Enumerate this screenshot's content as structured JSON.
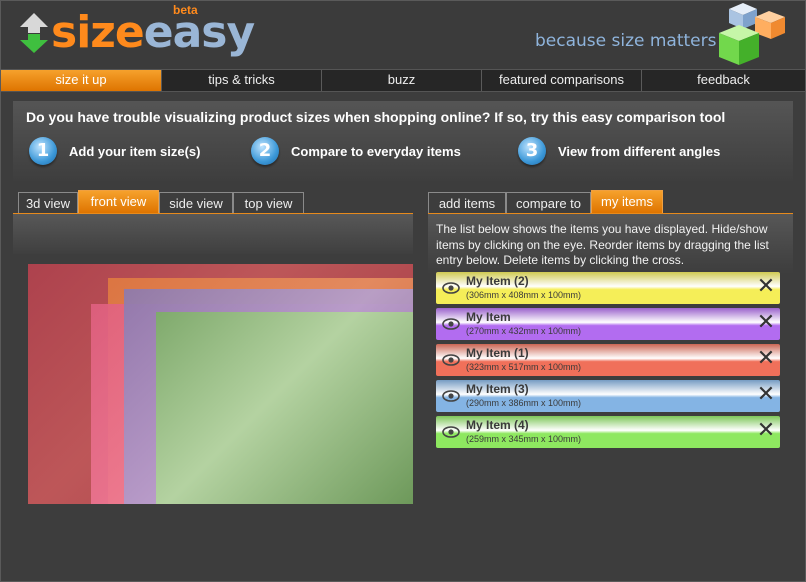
{
  "logo": {
    "text_size": "size",
    "text_easy": "easy",
    "badge": "beta",
    "tagline": "because size matters"
  },
  "nav": {
    "items": [
      {
        "label": "size it up",
        "active": true
      },
      {
        "label": "tips & tricks",
        "active": false
      },
      {
        "label": "buzz",
        "active": false
      },
      {
        "label": "featured comparisons",
        "active": false
      },
      {
        "label": "feedback",
        "active": false
      }
    ]
  },
  "banner": {
    "title": "Do you have trouble visualizing product sizes when shopping online? If so, try this easy comparison tool",
    "steps": [
      {
        "number": "1",
        "label": "Add your item size(s)"
      },
      {
        "number": "2",
        "label": "Compare to everyday items"
      },
      {
        "number": "3",
        "label": "View from different angles"
      }
    ]
  },
  "view_tabs": [
    {
      "label": "3d view",
      "active": false
    },
    {
      "label": "front view",
      "active": true
    },
    {
      "label": "side view",
      "active": false
    },
    {
      "label": "top view",
      "active": false
    }
  ],
  "item_tabs": [
    {
      "label": "add items",
      "active": false
    },
    {
      "label": "compare to",
      "active": false
    },
    {
      "label": "my items",
      "active": true
    }
  ],
  "instructions": "The list below shows the items you have displayed. Hide/show items by clicking on the eye. Reorder items by dragging the list entry below. Delete items by clicking the cross.",
  "items": [
    {
      "name": "My Item (2)",
      "dims": "(306mm x 408mm x 100mm)",
      "color": "#f5ee58"
    },
    {
      "name": "My Item",
      "dims": "(270mm x 432mm x 100mm)",
      "color": "#b26cf0"
    },
    {
      "name": "My Item (1)",
      "dims": "(323mm x 517mm x 100mm)",
      "color": "#f0705a"
    },
    {
      "name": "My Item (3)",
      "dims": "(290mm x 386mm x 100mm)",
      "color": "#84b4e4"
    },
    {
      "name": "My Item (4)",
      "dims": "(259mm x 345mm x 100mm)",
      "color": "#8ee860"
    }
  ],
  "delete_glyph": "✕",
  "colors": {
    "accent_orange": "#de7400",
    "background": "#3d3d3d"
  }
}
